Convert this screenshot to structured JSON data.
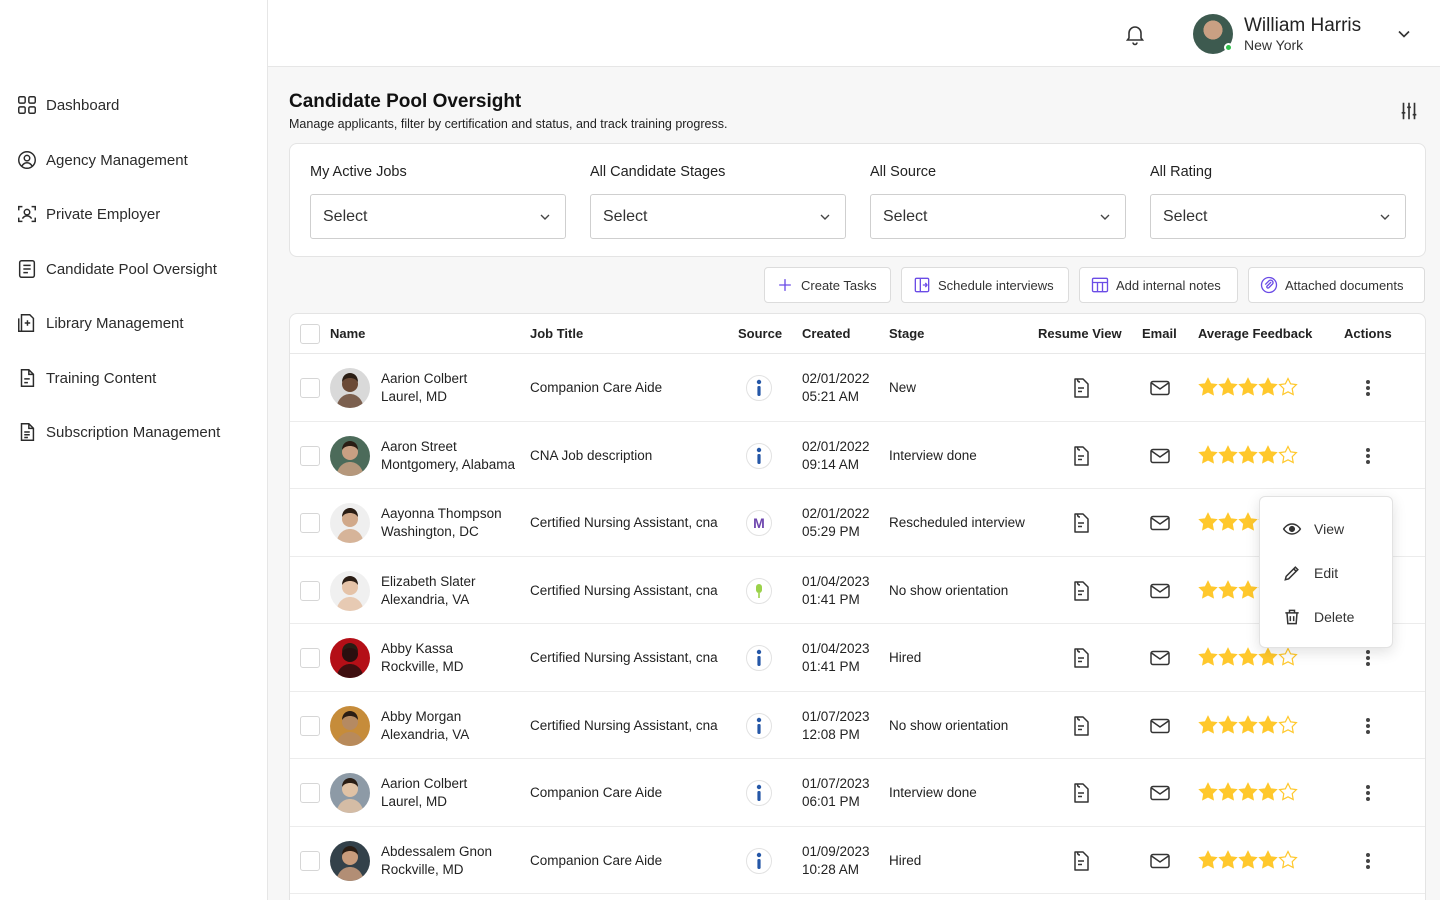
{
  "sidebar": {
    "items": [
      {
        "label": "Dashboard",
        "icon": "grid-icon"
      },
      {
        "label": "Agency Management",
        "icon": "user-circle-icon"
      },
      {
        "label": "Private Employer",
        "icon": "face-scan-icon"
      },
      {
        "label": "Candidate Pool Oversight",
        "icon": "list-doc-icon"
      },
      {
        "label": "Library Management",
        "icon": "doc-plus-icon"
      },
      {
        "label": "Training Content",
        "icon": "file-icon"
      },
      {
        "label": "Subscription Management",
        "icon": "file-text-icon"
      }
    ]
  },
  "header": {
    "user_name": "William Harris",
    "user_location": "New York"
  },
  "page": {
    "title": "Candidate Pool Oversight",
    "subtitle": "Manage applicants, filter by certification and status, and track training progress."
  },
  "filters": [
    {
      "label": "My Active Jobs",
      "value": "Select"
    },
    {
      "label": "All Candidate Stages",
      "value": "Select"
    },
    {
      "label": "All Source",
      "value": "Select"
    },
    {
      "label": "All Rating",
      "value": "Select"
    }
  ],
  "toolbar": {
    "create_tasks": "Create Tasks",
    "schedule_interviews": "Schedule interviews",
    "add_notes": "Add internal notes",
    "attached_docs": "Attached documents"
  },
  "table": {
    "headers": {
      "name": "Name",
      "job_title": "Job Title",
      "source": "Source",
      "created": "Created",
      "stage": "Stage",
      "resume": "Resume View",
      "email": "Email",
      "feedback": "Average Feedback",
      "actions": "Actions"
    },
    "rows": [
      {
        "name": "Aarion Colbert",
        "location": "Laurel, MD",
        "job": "Companion Care Aide",
        "source": "indeed",
        "date": "02/01/2022",
        "time": "05:21 AM",
        "stage": "New",
        "rating": 4,
        "skin": "#6b4a36",
        "bg": "#d9d9d9"
      },
      {
        "name": "Aaron Street",
        "location": "Montgomery, Alabama",
        "job": "CNA Job description",
        "source": "indeed",
        "date": "02/01/2022",
        "time": "09:14 AM",
        "stage": "Interview done",
        "rating": 4,
        "skin": "#c9a083",
        "bg": "#4c6b5a"
      },
      {
        "name": "Aayonna Thompson",
        "location": "Washington, DC",
        "job": "Certified Nursing Assistant, cna",
        "source": "monster",
        "date": "02/01/2022",
        "time": "05:29 PM",
        "stage": "Rescheduled interview",
        "rating": 4,
        "skin": "#d1a98a",
        "bg": "#efefef"
      },
      {
        "name": "Elizabeth Slater",
        "location": "Alexandria, VA",
        "job": "Certified Nursing Assistant, cna",
        "source": "other",
        "date": "01/04/2023",
        "time": "01:41 PM",
        "stage": "No show orientation",
        "rating": 4,
        "skin": "#e5c3a8",
        "bg": "#f0f0f0"
      },
      {
        "name": "Abby Kassa",
        "location": "Rockville, MD",
        "job": "Certified Nursing Assistant, cna",
        "source": "indeed",
        "date": "01/04/2023",
        "time": "01:41 PM",
        "stage": "Hired",
        "rating": 4,
        "skin": "#2a0f0f",
        "bg": "#b40f17"
      },
      {
        "name": "Abby Morgan",
        "location": "Alexandria, VA",
        "job": "Certified Nursing Assistant, cna",
        "source": "indeed",
        "date": "01/07/2023",
        "time": "12:08 PM",
        "stage": "No show orientation",
        "rating": 4,
        "skin": "#b58a62",
        "bg": "#c68c3a"
      },
      {
        "name": "Aarion Colbert",
        "location": "Laurel, MD",
        "job": "Companion Care Aide",
        "source": "indeed",
        "date": "01/07/2023",
        "time": "06:01 PM",
        "stage": "Interview done",
        "rating": 4,
        "skin": "#e0c2a5",
        "bg": "#8d9aa6"
      },
      {
        "name": "Abdessalem Gnon",
        "location": "Rockville, MD",
        "job": "Companion Care Aide",
        "source": "indeed",
        "date": "01/09/2023",
        "time": "10:28 AM",
        "stage": "Hired",
        "rating": 4,
        "skin": "#c99c7c",
        "bg": "#33414a"
      }
    ]
  },
  "context_menu": {
    "view": "View",
    "edit": "Edit",
    "delete": "Delete"
  },
  "colors": {
    "accent": "#6b4ce6",
    "star": "#ffc82c",
    "indeed": "#2557a7",
    "monster": "#6e46ae",
    "online": "#31c14d"
  }
}
